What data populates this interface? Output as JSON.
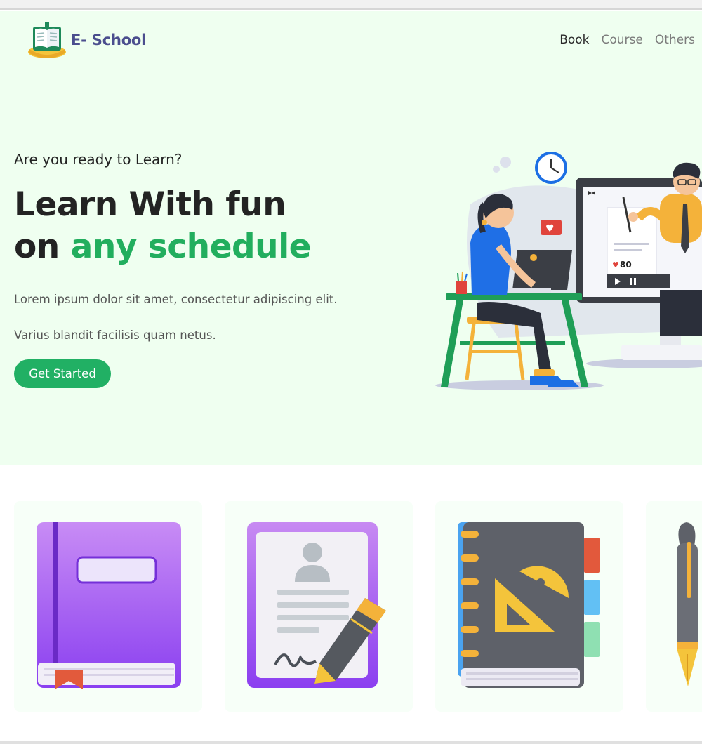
{
  "brand": {
    "name": "E- School",
    "logo_icon": "open-book-emblem-icon"
  },
  "nav": {
    "items": [
      {
        "label": "Book",
        "active": true
      },
      {
        "label": "Course",
        "active": false
      },
      {
        "label": "Others",
        "active": false
      }
    ]
  },
  "hero": {
    "tagline": "Are you ready to Learn?",
    "headline_line1": "Learn With fun",
    "headline_line2_prefix": "on ",
    "headline_line2_accent": "any schedule",
    "paragraph1": "Lorem ipsum dolor sit amet, consectetur adipiscing elit.",
    "paragraph2": "Varius blandit facilisis quam netus.",
    "cta_label": "Get Started",
    "illustration": {
      "viewer_count": "80",
      "icon": "online-learning-illustration"
    }
  },
  "cards": [
    {
      "icon": "purple-book-icon"
    },
    {
      "icon": "document-signing-pen-icon"
    },
    {
      "icon": "notebook-ruler-protractor-icon"
    },
    {
      "icon": "fountain-pen-icon"
    }
  ],
  "colors": {
    "accent": "#22ae5e",
    "brand": "#4b4e8e",
    "hero_bg": "#effff0",
    "card_bg": "#f7fff8"
  }
}
